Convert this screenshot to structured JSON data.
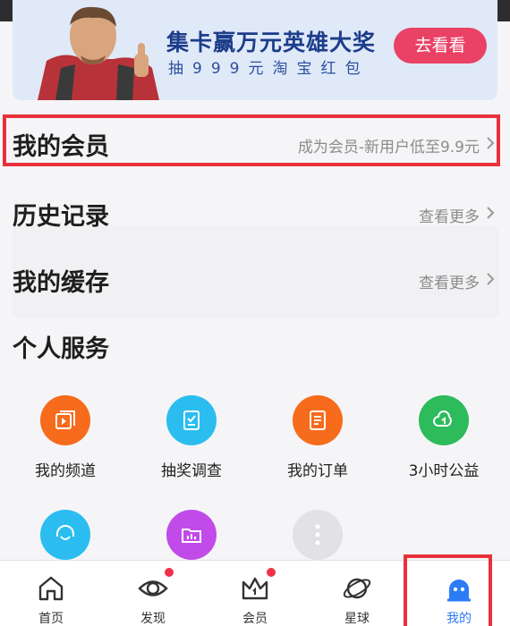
{
  "banner": {
    "title": "集卡赢万元英雄大奖",
    "subtitle": "抽999元淘宝红包",
    "button": "去看看"
  },
  "rows": {
    "member": {
      "title": "我的会员",
      "right": "成为会员-新用户低至9.9元"
    },
    "history": {
      "title": "历史记录",
      "right": "查看更多"
    },
    "cache": {
      "title": "我的缓存",
      "right": "查看更多"
    }
  },
  "services": {
    "title": "个人服务",
    "items": [
      {
        "label": "我的频道",
        "icon": "channel-icon",
        "color": "#f76b1c"
      },
      {
        "label": "抽奖调查",
        "icon": "survey-icon",
        "color": "#2bbdf0"
      },
      {
        "label": "我的订单",
        "icon": "order-icon",
        "color": "#f76b1c"
      },
      {
        "label": "3小时公益",
        "icon": "charity-icon",
        "color": "#2dbb5b"
      },
      {
        "label": "",
        "icon": "support-icon",
        "color": "#2bbdf0"
      },
      {
        "label": "",
        "icon": "folder-icon",
        "color": "#c14be8"
      },
      {
        "label": "",
        "icon": "more-icon",
        "color": "#dcdcdc"
      }
    ]
  },
  "tabbar": {
    "items": [
      {
        "label": "首页",
        "icon": "home-icon"
      },
      {
        "label": "发现",
        "icon": "eye-icon",
        "badge": true
      },
      {
        "label": "会员",
        "icon": "crown-icon",
        "badge": true
      },
      {
        "label": "星球",
        "icon": "planet-icon"
      },
      {
        "label": "我的",
        "icon": "profile-icon",
        "active": true
      }
    ],
    "active_color": "#2c7cf6"
  }
}
